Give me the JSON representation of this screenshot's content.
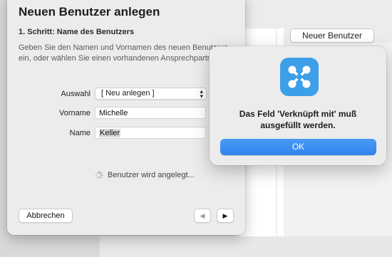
{
  "sheet": {
    "title": "Neuen Benutzer anlegen",
    "step_title": "1. Schritt: Name des Benutzers",
    "description_line1": "Geben Sie den Namen und Vornamen des neuen Benutzers",
    "description_line2": "ein, oder wählen Sie einen vorhandenen Ansprechpartner",
    "fields": {
      "auswahl_label": "Auswahl",
      "auswahl_value": "[ Neu anlegen ]",
      "vorname_label": "Vorname",
      "vorname_value": "Michelle",
      "name_label": "Name",
      "name_value": "Keller"
    },
    "progress_text": "Benutzer wird angelegt...",
    "cancel_label": "Abbrechen",
    "back_label": "◀",
    "forward_label": "▶"
  },
  "background": {
    "new_user_button": "Neuer Benutzer"
  },
  "alert": {
    "icon": "app-icon-x",
    "message_line1": "Das Feld 'Verknüpft mit' muß",
    "message_line2": "ausgefüllt werden.",
    "ok_label": "OK"
  },
  "colors": {
    "accent": "#2f84ee",
    "icon_bg": "#3d9fe8"
  }
}
